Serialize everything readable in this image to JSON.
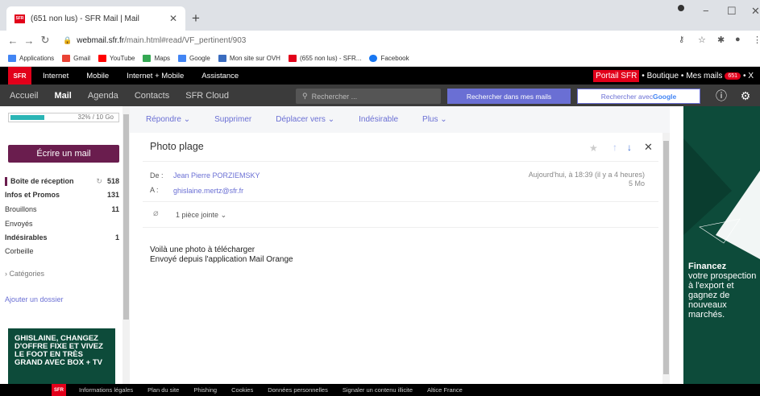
{
  "browser": {
    "tab_title": "(651 non lus) - SFR Mail | Mail",
    "tab_favicon": "SFR",
    "url_host": "webmail.sfr.fr",
    "url_path": "/main.html#read/VF_pertinent/903",
    "bookmarks": [
      {
        "label": "Applications",
        "color": "#4285f4"
      },
      {
        "label": "Gmail",
        "color": "#ea4335"
      },
      {
        "label": "YouTube",
        "color": "#ff0000"
      },
      {
        "label": "Maps",
        "color": "#34a853"
      },
      {
        "label": "Google",
        "color": "#4285f4"
      },
      {
        "label": "Mon site sur OVH",
        "color": "#3a6cbf"
      },
      {
        "label": "(655 non lus) - SFR...",
        "color": "#e2001a"
      },
      {
        "label": "Facebook",
        "color": "#1877f2"
      }
    ]
  },
  "sfr_topnav": {
    "logo": "SFR",
    "items": [
      "Internet",
      "Mobile",
      "Internet + Mobile",
      "Assistance"
    ],
    "portal": "Portail SFR",
    "boutique": "• Boutique •",
    "mes_mails": "Mes mails",
    "count": "651",
    "close": "• X"
  },
  "appbar": {
    "items": [
      "Accueil",
      "Mail",
      "Agenda",
      "Contacts",
      "SFR Cloud"
    ],
    "search_placeholder": "Rechercher ...",
    "search_mails_btn": "Rechercher dans mes mails",
    "search_google_btn": "Rechercher avec ",
    "google": "Google"
  },
  "sidebar": {
    "quota_text": "32% / 10 Go",
    "quota_fraction": 0.32,
    "compose": "Écrire un mail",
    "folders": [
      {
        "label": "Boîte de réception",
        "count": "518",
        "bold": true
      },
      {
        "label": "Infos et Promos",
        "count": "131",
        "bold": true
      },
      {
        "label": "Brouillons",
        "count": "11",
        "bold": false
      },
      {
        "label": "Envoyés",
        "count": "",
        "bold": false
      },
      {
        "label": "Indésirables",
        "count": "1",
        "bold": true
      },
      {
        "label": "Corbeille",
        "count": "",
        "bold": false
      }
    ],
    "categories": "Catégories",
    "add_folder": "Ajouter un dossier",
    "ad_text": "GHISLAINE, CHANGEZ D'OFFRE FIXE ET VIVEZ LE FOOT EN TRÈS GRAND AVEC BOX + TV"
  },
  "toolbar": {
    "reply": "Répondre",
    "delete": "Supprimer",
    "move": "Déplacer vers",
    "junk": "Indésirable",
    "more": "Plus"
  },
  "message": {
    "subject": "Photo plage",
    "from_label": "De :",
    "from": "Jean Pierre PORZIEMSKY",
    "to_label": "A :",
    "to": "ghislaine.mertz@sfr.fr",
    "date": "Aujourd'hui, à 18:39 (il y a 4 heures)",
    "size": "5 Mo",
    "attachments": "1 pièce jointe",
    "body_line1": "Voilà une photo à télécharger",
    "body_line2": "Envoyé depuis l'application Mail Orange"
  },
  "right_ad": {
    "heading": "Financez",
    "text": "votre prospection à l'export et gagnez de nouveaux marchés."
  },
  "footer": {
    "logo": "SFR",
    "links": [
      "Informations légales",
      "Plan du site",
      "Phishing",
      "Cookies",
      "Données personnelles",
      "Signaler un contenu illicite",
      "Altice France"
    ]
  }
}
